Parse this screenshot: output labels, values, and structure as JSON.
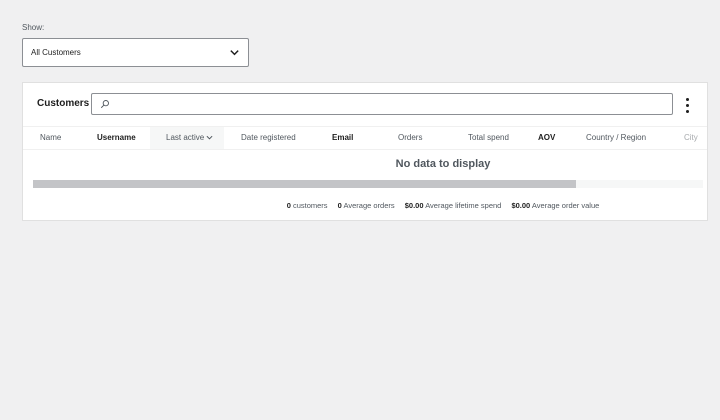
{
  "filter": {
    "label": "Show:",
    "selected": "All Customers"
  },
  "card": {
    "title": "Customers",
    "search_placeholder": ""
  },
  "table": {
    "columns": [
      {
        "label": "Name",
        "style": "normal"
      },
      {
        "label": "Username",
        "style": "bold"
      },
      {
        "label": "Last active",
        "style": "sorted"
      },
      {
        "label": "Date registered",
        "style": "normal"
      },
      {
        "label": "Email",
        "style": "bold"
      },
      {
        "label": "Orders",
        "style": "normal"
      },
      {
        "label": "Total spend",
        "style": "normal"
      },
      {
        "label": "AOV",
        "style": "bold"
      },
      {
        "label": "Country / Region",
        "style": "normal"
      },
      {
        "label": "City",
        "style": "muted"
      }
    ],
    "empty_message": "No data to display"
  },
  "summary": [
    {
      "value": "0",
      "label": "customers"
    },
    {
      "value": "0",
      "label": "Average orders"
    },
    {
      "value": "$0.00",
      "label": "Average lifetime spend"
    },
    {
      "value": "$0.00",
      "label": "Average order value"
    }
  ],
  "scroll_position_fraction": 0.81
}
